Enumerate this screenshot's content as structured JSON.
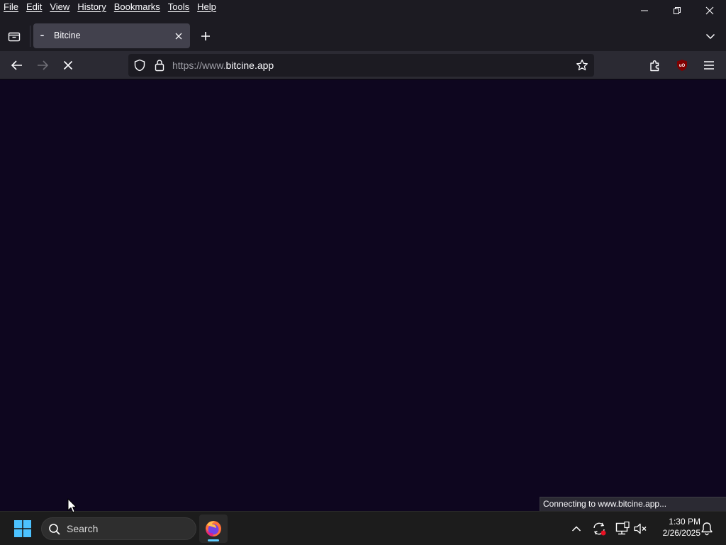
{
  "menubar": {
    "items": [
      {
        "label": "File"
      },
      {
        "label": "Edit"
      },
      {
        "label": "View"
      },
      {
        "label": "History"
      },
      {
        "label": "Bookmarks"
      },
      {
        "label": "Tools"
      },
      {
        "label": "Help"
      }
    ]
  },
  "window_controls": {
    "minimize_icon": "minimize-icon",
    "restore_icon": "restore-icon",
    "close_icon": "close-icon"
  },
  "tabs": [
    {
      "title": "Bitcine",
      "state": "loading",
      "active": true
    }
  ],
  "navbar": {
    "url_prefix": "https://www.",
    "url_domain": "bitcine.app",
    "stop_icon": "stop-icon"
  },
  "status": {
    "text": "Connecting to www.bitcine.app..."
  },
  "taskbar": {
    "search_label": "Search",
    "pinned_app_icon": "firefox-icon",
    "clock_time": "1:30 PM",
    "clock_date": "2/26/2025"
  },
  "colors": {
    "page_background": "#0e061f",
    "toolbar": "#2b2a33",
    "tabstrip": "#1c1b22",
    "active_tab": "#42414d",
    "taskbar": "#1c1c1c",
    "accent": "#60cdff",
    "ublock_red": "#800000"
  }
}
